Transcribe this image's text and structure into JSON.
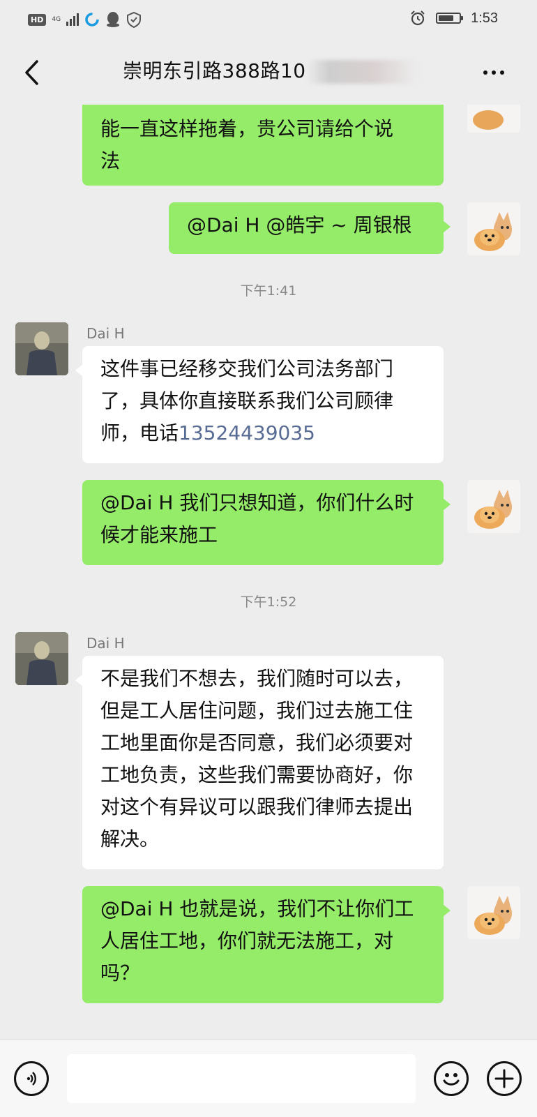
{
  "status_bar": {
    "network": "HD",
    "signal_type": "4G",
    "time": "1:53",
    "icons": [
      "hd-badge-icon",
      "signal-icon",
      "sync-icon",
      "qq-icon",
      "shield-icon",
      "alarm-icon",
      "battery-icon"
    ],
    "battery_level": 0.75
  },
  "header": {
    "back_icon": "chevron-left-icon",
    "title": "崇明东引路388路10",
    "more_icon": "more-dots-icon"
  },
  "messages": [
    {
      "side": "me",
      "lines": [
        "能一直这样拖着，贵公司请给个说",
        "法"
      ]
    },
    {
      "side": "me",
      "text": "@Dai H @皓宇 ~ 周银根"
    },
    {
      "timestamp": "下午1:41"
    },
    {
      "side": "other",
      "sender": "Dai H",
      "text": "这件事已经移交我们公司法务部门了，具体你直接联系我们公司顾律师，电话",
      "phone": "13524439035"
    },
    {
      "side": "me",
      "text": "@Dai H  我们只想知道，你们什么时候才能来施工"
    },
    {
      "timestamp": "下午1:52"
    },
    {
      "side": "other",
      "sender": "Dai H",
      "text": "不是我们不想去，我们随时可以去，但是工人居住问题，我们过去施工住工地里面你是否同意，我们必须要对工地负责，这些我们需要协商好，你对这个有异议可以跟我们律师去提出解决。"
    },
    {
      "side": "me",
      "text": "@Dai H  也就是说，我们不让你们工人居住工地，你们就无法施工，对吗？"
    }
  ],
  "input_bar": {
    "voice_icon": "voice-icon",
    "input_value": "",
    "emoji_icon": "emoji-icon",
    "plus_icon": "plus-icon"
  },
  "colors": {
    "background": "#ededed",
    "my_bubble": "#95ec69",
    "other_bubble": "#ffffff",
    "link": "#576b95"
  }
}
